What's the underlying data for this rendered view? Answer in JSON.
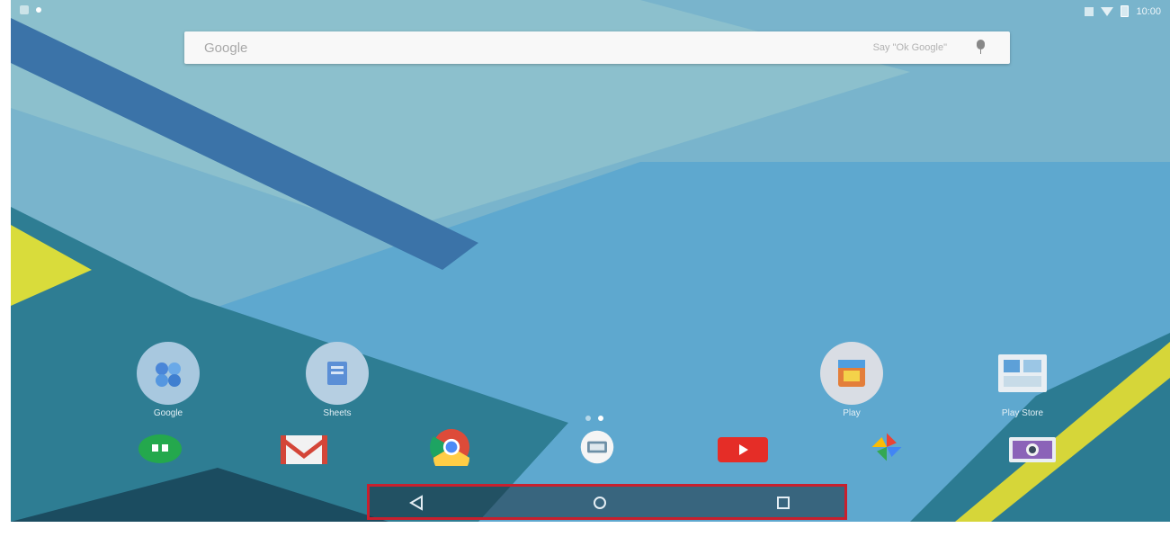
{
  "status_bar": {
    "time": "10:00"
  },
  "search": {
    "brand": "Google",
    "hint": "Say \"Ok Google\"",
    "mic_icon": "mic-icon"
  },
  "home_apps": [
    {
      "name": "google-folder",
      "label": "Google"
    },
    {
      "name": "files-app",
      "label": "Sheets"
    },
    {
      "name": "play-store",
      "label": "Play"
    },
    {
      "name": "play-folder",
      "label": "Play Store"
    }
  ],
  "dock_apps": [
    {
      "name": "hangouts-icon"
    },
    {
      "name": "gmail-icon"
    },
    {
      "name": "chrome-icon"
    },
    {
      "name": "messenger-icon"
    },
    {
      "name": "youtube-icon"
    },
    {
      "name": "photos-icon"
    },
    {
      "name": "camera-icon"
    }
  ],
  "pager": {
    "pages": 2,
    "current": 2
  },
  "nav": {
    "back": "back-icon",
    "home": "home-icon",
    "recent": "recent-apps-icon"
  },
  "colors": {
    "highlight": "#c8202e",
    "wallpaper": "#5fa9cf",
    "accent": "#e6e23b"
  }
}
